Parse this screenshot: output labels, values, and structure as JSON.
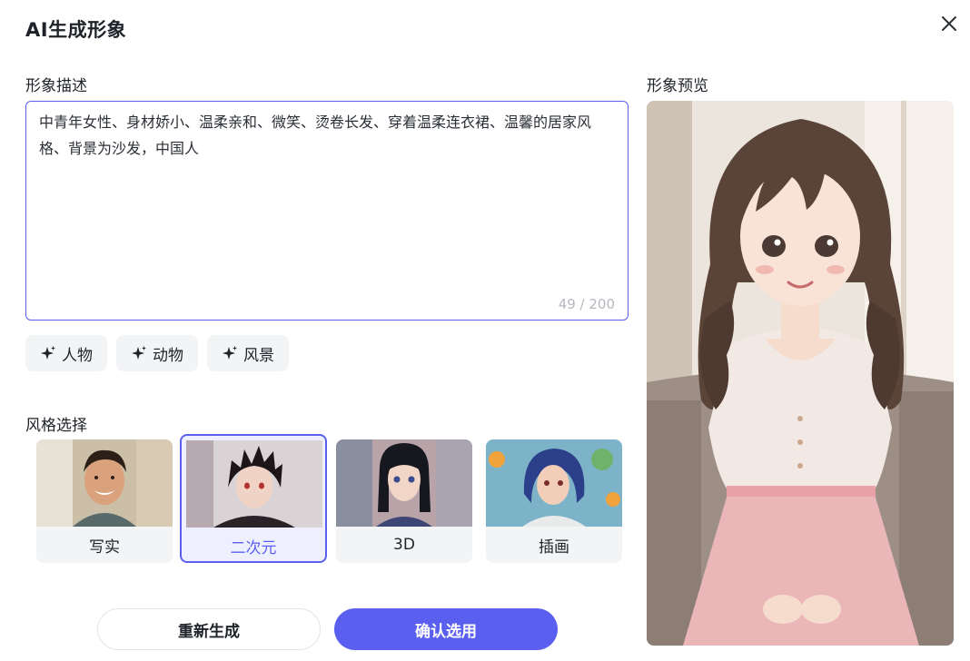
{
  "dialog": {
    "title": "AI生成形象"
  },
  "description": {
    "label": "形象描述",
    "text": "中青年女性、身材娇小、温柔亲和、微笑、烫卷长发、穿着温柔连衣裙、温馨的居家风格、背景为沙发，中国人",
    "counter": "49 / 200"
  },
  "tags": [
    {
      "label": "人物",
      "icon": "sparkle-icon"
    },
    {
      "label": "动物",
      "icon": "sparkle-icon"
    },
    {
      "label": "风景",
      "icon": "sparkle-icon"
    }
  ],
  "style": {
    "label": "风格选择",
    "options": [
      {
        "label": "写实",
        "selected": false
      },
      {
        "label": "二次元",
        "selected": true
      },
      {
        "label": "3D",
        "selected": false
      },
      {
        "label": "插画",
        "selected": false
      }
    ]
  },
  "preview": {
    "label": "形象预览"
  },
  "actions": {
    "regenerate": "重新生成",
    "confirm": "确认选用"
  },
  "colors": {
    "accent": "#5b5ff0",
    "tag_bg": "#f3f4f6",
    "counter": "#b5b8bf"
  }
}
